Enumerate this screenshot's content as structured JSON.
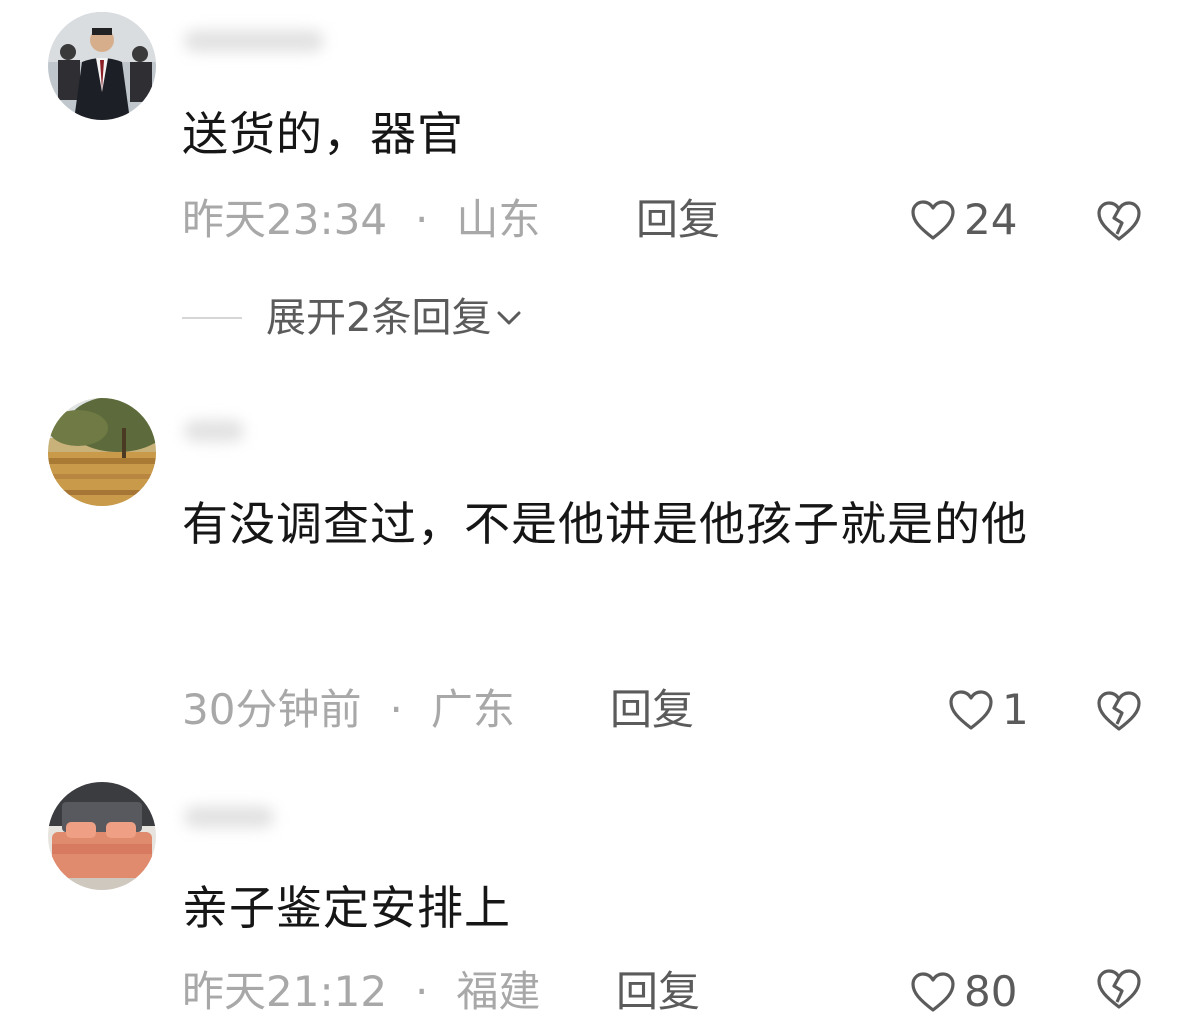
{
  "comments": [
    {
      "text": "送货的，器官",
      "time": "昨天23:34",
      "separator": "·",
      "location": "山东",
      "reply": "回复",
      "likes": "24",
      "expand_replies": "展开2条回复"
    },
    {
      "text": "有没调查过，不是他讲是他孩子就是的他",
      "time": "30分钟前",
      "separator": "·",
      "location": "广东",
      "reply": "回复",
      "likes": "1"
    },
    {
      "text": "亲子鉴定安排上",
      "time": "昨天21:12",
      "separator": "·",
      "location": "福建",
      "reply": "回复",
      "likes": "80"
    }
  ],
  "icons": {
    "like": "heart-outline-icon",
    "dislike": "broken-heart-icon",
    "expand": "chevron-down-icon"
  },
  "colors": {
    "text": "#161616",
    "meta": "#a8a8a8",
    "action": "#5b5b5b"
  }
}
